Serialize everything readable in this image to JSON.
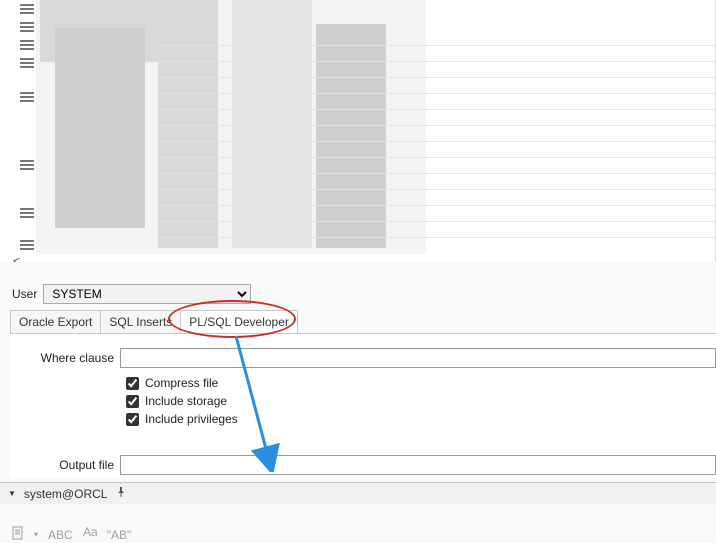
{
  "user": {
    "label": "User",
    "selected": "SYSTEM",
    "options": [
      "SYSTEM"
    ]
  },
  "tabs": [
    {
      "label": "Oracle Export",
      "active": false
    },
    {
      "label": "SQL Inserts",
      "active": false
    },
    {
      "label": "PL/SQL Developer",
      "active": true
    }
  ],
  "form": {
    "where_clause": {
      "label": "Where clause",
      "value": ""
    },
    "compress": {
      "label": "Compress file",
      "checked": true
    },
    "storage": {
      "label": "Include storage",
      "checked": true
    },
    "privileges": {
      "label": "Include privileges",
      "checked": true
    },
    "output_file": {
      "label": "Output file",
      "value": ""
    }
  },
  "status": {
    "connection": "system@ORCL"
  },
  "bottom_toolbar": {
    "i1": "ABC",
    "i2": "\"AB\""
  },
  "scroll_indicator": "<"
}
